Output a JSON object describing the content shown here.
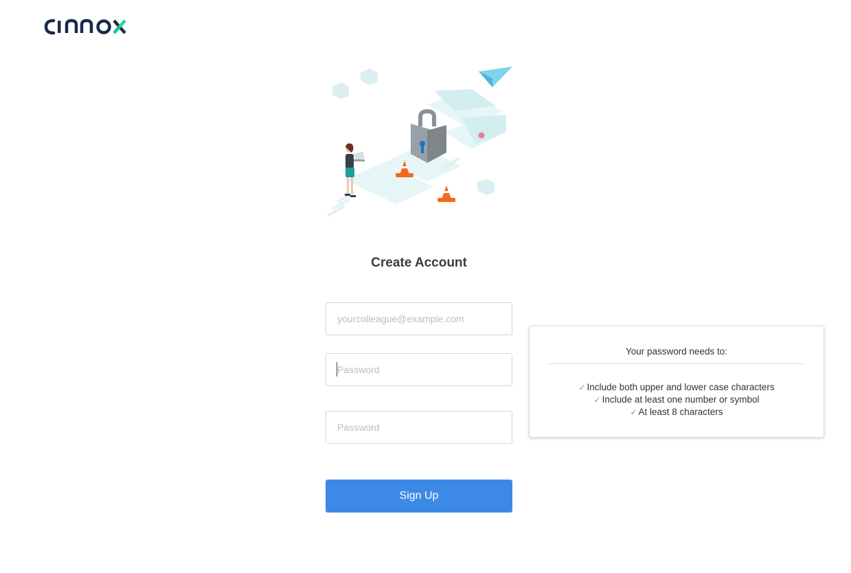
{
  "brand": {
    "logo_text": "cinnox",
    "logo_colors": {
      "primary": "#1a2b4a",
      "accent": "#18c48f"
    }
  },
  "illustration": {
    "icon": "security-lock-illustration"
  },
  "form": {
    "title": "Create Account",
    "email": {
      "placeholder": "yourcolleague@example.com",
      "value": ""
    },
    "password": {
      "placeholder": "Password",
      "value": ""
    },
    "confirm_password": {
      "placeholder": "Password",
      "value": ""
    },
    "submit_label": "Sign Up",
    "submit_color": "#3d8ae6"
  },
  "password_rules": {
    "heading": "Your password needs to:",
    "items": [
      {
        "text": "Include both upper and lower case characters",
        "icon": "check-icon",
        "met": true
      },
      {
        "text": "Include at least one number or symbol",
        "icon": "check-icon",
        "met": true
      },
      {
        "text": "At least 8 characters",
        "icon": "check-icon",
        "met": true
      }
    ],
    "check_color": "#3fbf6a"
  }
}
